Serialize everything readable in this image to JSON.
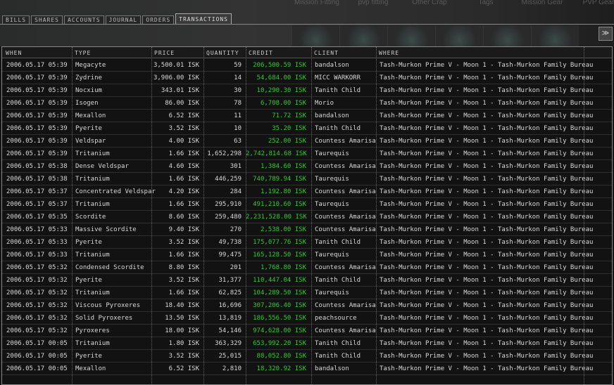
{
  "top_nav": [
    "Mission Fitting",
    "pvp fitting",
    "Other Crap",
    "Tags",
    "Mission Gear",
    "PVP Gear"
  ],
  "tabs": [
    "BILLS",
    "SHARES",
    "ACCOUNTS",
    "JOURNAL",
    "ORDERS",
    "TRANSACTIONS"
  ],
  "active_tab": "TRANSACTIONS",
  "columns": [
    "WHEN",
    "TYPE",
    "PRICE",
    "QUANTITY",
    "CREDIT",
    "CLIENT",
    "WHERE"
  ],
  "credit_color": "#2ecc2e",
  "rows": [
    [
      "2006.05.17 05:39",
      "Megacyte",
      "3,500.01 ISK",
      "59",
      "206,500.59 ISK",
      "bandalson",
      "Tash-Murkon Prime V - Moon 1 - Tash-Murkon Family Bureau"
    ],
    [
      "2006.05.17 05:39",
      "Zydrine",
      "3,906.00 ISK",
      "14",
      "54,684.00 ISK",
      "MICC WARKORR",
      "Tash-Murkon Prime V - Moon 1 - Tash-Murkon Family Bureau"
    ],
    [
      "2006.05.17 05:39",
      "Nocxium",
      "343.01 ISK",
      "30",
      "10,290.30 ISK",
      "Tanith Child",
      "Tash-Murkon Prime V - Moon 1 - Tash-Murkon Family Bureau"
    ],
    [
      "2006.05.17 05:39",
      "Isogen",
      "86.00 ISK",
      "78",
      "6,708.00 ISK",
      "Morio",
      "Tash-Murkon Prime V - Moon 1 - Tash-Murkon Family Bureau"
    ],
    [
      "2006.05.17 05:39",
      "Mexallon",
      "6.52 ISK",
      "11",
      "71.72 ISK",
      "bandalson",
      "Tash-Murkon Prime V - Moon 1 - Tash-Murkon Family Bureau"
    ],
    [
      "2006.05.17 05:39",
      "Pyerite",
      "3.52 ISK",
      "10",
      "35.20 ISK",
      "Tanith Child",
      "Tash-Murkon Prime V - Moon 1 - Tash-Murkon Family Bureau"
    ],
    [
      "2006.05.17 05:39",
      "Veldspar",
      "4.00 ISK",
      "63",
      "252.00 ISK",
      "Countess Amarisa",
      "Tash-Murkon Prime V - Moon 1 - Tash-Murkon Family Bureau"
    ],
    [
      "2006.05.17 05:39",
      "Tritanium",
      "1.66 ISK",
      "1,652,298",
      "2,742,814.68 ISK",
      "Taurequis",
      "Tash-Murkon Prime V - Moon 1 - Tash-Murkon Family Bureau"
    ],
    [
      "2006.05.17 05:38",
      "Dense Veldspar",
      "4.60 ISK",
      "301",
      "1,384.60 ISK",
      "Countess Amarisa",
      "Tash-Murkon Prime V - Moon 1 - Tash-Murkon Family Bureau"
    ],
    [
      "2006.05.17 05:38",
      "Tritanium",
      "1.66 ISK",
      "446,259",
      "740,789.94 ISK",
      "Taurequis",
      "Tash-Murkon Prime V - Moon 1 - Tash-Murkon Family Bureau"
    ],
    [
      "2006.05.17 05:37",
      "Concentrated Veldspar",
      "4.20 ISK",
      "284",
      "1,192.80 ISK",
      "Countess Amarisa",
      "Tash-Murkon Prime V - Moon 1 - Tash-Murkon Family Bureau"
    ],
    [
      "2006.05.17 05:37",
      "Tritanium",
      "1.66 ISK",
      "295,910",
      "491,210.60 ISK",
      "Taurequis",
      "Tash-Murkon Prime V - Moon 1 - Tash-Murkon Family Bureau"
    ],
    [
      "2006.05.17 05:35",
      "Scordite",
      "8.60 ISK",
      "259,480",
      "2,231,528.00 ISK",
      "Countess Amarisa",
      "Tash-Murkon Prime V - Moon 1 - Tash-Murkon Family Bureau"
    ],
    [
      "2006.05.17 05:33",
      "Massive Scordite",
      "9.40 ISK",
      "270",
      "2,538.00 ISK",
      "Countess Amarisa",
      "Tash-Murkon Prime V - Moon 1 - Tash-Murkon Family Bureau"
    ],
    [
      "2006.05.17 05:33",
      "Pyerite",
      "3.52 ISK",
      "49,738",
      "175,077.76 ISK",
      "Tanith Child",
      "Tash-Murkon Prime V - Moon 1 - Tash-Murkon Family Bureau"
    ],
    [
      "2006.05.17 05:33",
      "Tritanium",
      "1.66 ISK",
      "99,475",
      "165,128.50 ISK",
      "Taurequis",
      "Tash-Murkon Prime V - Moon 1 - Tash-Murkon Family Bureau"
    ],
    [
      "2006.05.17 05:32",
      "Condensed Scordite",
      "8.80 ISK",
      "201",
      "1,768.80 ISK",
      "Countess Amarisa",
      "Tash-Murkon Prime V - Moon 1 - Tash-Murkon Family Bureau"
    ],
    [
      "2006.05.17 05:32",
      "Pyerite",
      "3.52 ISK",
      "31,377",
      "110,447.04 ISK",
      "Tanith Child",
      "Tash-Murkon Prime V - Moon 1 - Tash-Murkon Family Bureau"
    ],
    [
      "2006.05.17 05:32",
      "Tritanium",
      "1.66 ISK",
      "62,825",
      "104,289.50 ISK",
      "Taurequis",
      "Tash-Murkon Prime V - Moon 1 - Tash-Murkon Family Bureau"
    ],
    [
      "2006.05.17 05:32",
      "Viscous Pyroxeres",
      "18.40 ISK",
      "16,696",
      "307,206.40 ISK",
      "Countess Amarisa",
      "Tash-Murkon Prime V - Moon 1 - Tash-Murkon Family Bureau"
    ],
    [
      "2006.05.17 05:32",
      "Solid Pyroxeres",
      "13.50 ISK",
      "13,819",
      "186,556.50 ISK",
      "peachsource",
      "Tash-Murkon Prime V - Moon 1 - Tash-Murkon Family Bureau"
    ],
    [
      "2006.05.17 05:32",
      "Pyroxeres",
      "18.00 ISK",
      "54,146",
      "974,628.00 ISK",
      "Countess Amarisa",
      "Tash-Murkon Prime V - Moon 1 - Tash-Murkon Family Bureau"
    ],
    [
      "2006.05.17 00:05",
      "Tritanium",
      "1.80 ISK",
      "363,329",
      "653,992.20 ISK",
      "Tanith Child",
      "Tash-Murkon Prime V - Moon 1 - Tash-Murkon Family Bureau"
    ],
    [
      "2006.05.17 00:05",
      "Pyerite",
      "3.52 ISK",
      "25,015",
      "88,052.80 ISK",
      "Tanith Child",
      "Tash-Murkon Prime V - Moon 1 - Tash-Murkon Family Bureau"
    ],
    [
      "2006.05.17 00:05",
      "Mexallon",
      "6.52 ISK",
      "2,810",
      "18,320.92 ISK",
      "bandalson",
      "Tash-Murkon Prime V - Moon 1 - Tash-Murkon Family Bureau"
    ]
  ]
}
